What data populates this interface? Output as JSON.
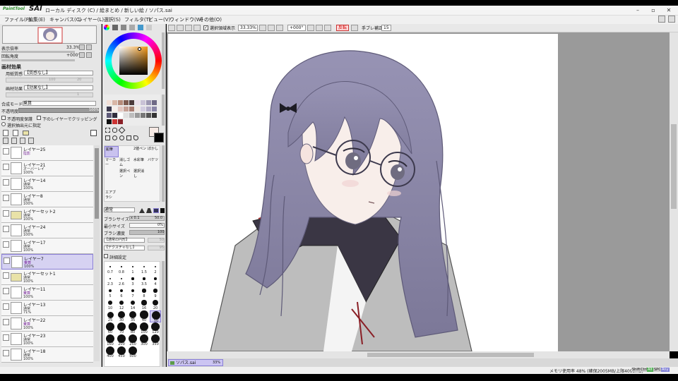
{
  "app": {
    "logo_small": "PaintTool",
    "logo_large": "SAI",
    "title": "ローカル ディスク (C) / 絵まとめ / 新しい絵 / ソパス.sai"
  },
  "window_buttons": {
    "minimize": "–",
    "maximize": "▫",
    "close": "✕"
  },
  "menu": [
    "ファイル(F)",
    "編集(E)",
    "キャンバス(C)",
    "レイヤー(L)",
    "選択(S)",
    "フィルタ(T)",
    "ビュー(V)",
    "ウィンドウ(W)",
    "その他(O)"
  ],
  "toolbar": {
    "show_selection_label": "選択領域表示",
    "zoom": "33.33%",
    "rotation": "+000°",
    "flip_label": "反転",
    "stabilizer_label": "手ブレ補正",
    "stabilizer_value": "15"
  },
  "navigator": {
    "zoom_label": "表示倍率",
    "zoom_value": "33.3%",
    "rotation_label": "回転角度",
    "rotation_value": "+000°"
  },
  "paper": {
    "section": "画材効果",
    "texture_label": "用紙質感",
    "texture_value": "【質感なし】",
    "effect_label": "画材効果",
    "effect_value": "【効果なし】",
    "val1": "100",
    "val2": "20",
    "val3": "1"
  },
  "layer_props": {
    "blend_label": "合成モード",
    "blend_value": "乗算",
    "opacity_label": "不透明度",
    "opacity_value": "100%",
    "protect_label": "不透明度保護",
    "clip_label": "下のレイヤーでクリッピング",
    "select_src_label": "選択抽出元に指定"
  },
  "layers": [
    {
      "name": "レイヤー25",
      "mode": "陰影",
      "opacity": "",
      "selected": false,
      "folder": false,
      "purple": true
    },
    {
      "name": "レイヤー21",
      "mode": "オーバーレイ",
      "opacity": "100%",
      "selected": false,
      "folder": false,
      "purple": false
    },
    {
      "name": "レイヤー14",
      "mode": "通常",
      "opacity": "100%",
      "selected": false,
      "folder": false,
      "purple": false
    },
    {
      "name": "レイヤー8",
      "mode": "通常",
      "opacity": "100%",
      "selected": false,
      "folder": false,
      "purple": false
    },
    {
      "name": "レイヤーセット2",
      "mode": "通常",
      "opacity": "100%",
      "selected": false,
      "folder": true,
      "purple": false
    },
    {
      "name": "レイヤー24",
      "mode": "通常",
      "opacity": "100%",
      "selected": false,
      "folder": false,
      "purple": false
    },
    {
      "name": "レイヤー17",
      "mode": "通常",
      "opacity": "100%",
      "selected": false,
      "folder": false,
      "purple": false
    },
    {
      "name": "レイヤー7",
      "mode": "乗算",
      "opacity": "100%",
      "selected": true,
      "folder": false,
      "purple": true
    },
    {
      "name": "レイヤーセット1",
      "mode": "通常",
      "opacity": "100%",
      "selected": false,
      "folder": true,
      "purple": false
    },
    {
      "name": "レイヤー11",
      "mode": "乗算",
      "opacity": "100%",
      "selected": false,
      "folder": false,
      "purple": true
    },
    {
      "name": "レイヤー13",
      "mode": "通常",
      "opacity": "71%",
      "selected": false,
      "folder": false,
      "purple": false
    },
    {
      "name": "レイヤー22",
      "mode": "乗算",
      "opacity": "100%",
      "selected": false,
      "folder": false,
      "purple": true
    },
    {
      "name": "レイヤー23",
      "mode": "通常",
      "opacity": "100%",
      "selected": false,
      "folder": false,
      "purple": false
    },
    {
      "name": "レイヤー18",
      "mode": "通常",
      "opacity": "100%",
      "selected": false,
      "folder": false,
      "purple": false
    }
  ],
  "tools": {
    "row1": [
      "鉛筆",
      "2値ペン",
      "ぼかし"
    ],
    "row2": [
      "マーカー",
      "消しゴム",
      "水彩筆",
      "バケツ"
    ],
    "row3": [
      "選択ペン",
      "選択消し"
    ],
    "row4": [
      "エアブラシ"
    ]
  },
  "brush": {
    "mode": "通常",
    "size_label": "ブラシサイズ",
    "size_mult": "x 0.1",
    "size_value": "50.0",
    "min_label": "最小サイズ",
    "min_value": "0%",
    "density_label": "ブラシ濃度",
    "density_value": "100",
    "shape": "【通常の円形】",
    "texture": "【テクスチャなし】",
    "shape_val": "50",
    "texture_val": "95",
    "detail_label": "詳細設定"
  },
  "brush_sizes": [
    [
      "0.7",
      "0.8",
      "1",
      "1.5",
      "2"
    ],
    [
      "2.3",
      "2.6",
      "3",
      "3.5",
      "4"
    ],
    [
      "5",
      "6",
      "7",
      "8",
      "9"
    ],
    [
      "10",
      "12",
      "14",
      "16",
      "20"
    ],
    [
      "25",
      "30",
      "35",
      "40",
      "50"
    ],
    [
      "60",
      "70",
      "80",
      "100",
      "120"
    ],
    [
      "160",
      "200",
      "250",
      "300",
      "350"
    ],
    [
      "400",
      "450",
      "500",
      "",
      ""
    ]
  ],
  "file_tab": {
    "name": "ソパス.sai",
    "zoom": "33%"
  },
  "status": {
    "memory": "メモリ使用率 48% (確保2005MB/上限4095MB)",
    "keys": [
      "Shift",
      "Ctrl",
      "Alt",
      "SPC",
      "Any"
    ]
  },
  "colors": {
    "panel": "#e6e6e6",
    "accent": "#d6d2f2",
    "canvas_bg": "#9a9a9a",
    "hair": "#8a86a8"
  }
}
